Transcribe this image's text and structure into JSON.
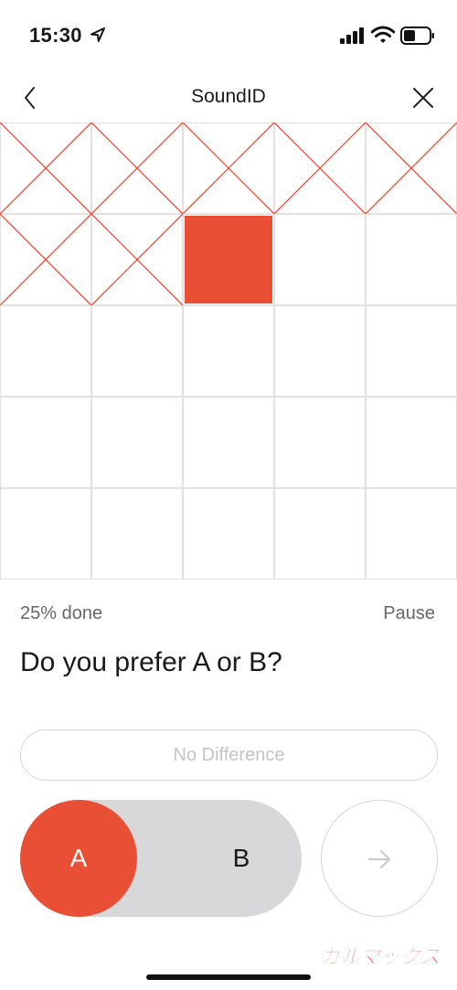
{
  "status_bar": {
    "time": "15:30",
    "icons": [
      "location-arrow-icon",
      "cellular-signal-icon",
      "wifi-icon",
      "battery-icon"
    ]
  },
  "nav": {
    "title": "SoundID",
    "back_icon": "chevron-left-icon",
    "close_icon": "close-icon"
  },
  "progress_grid": {
    "rows": 5,
    "columns": 5,
    "completed_cells": 7,
    "current_cell": 8,
    "total_cells": 25,
    "completed_marker": "cross",
    "accent_color": "#e94f35",
    "grid_line_color": "#e2e2e2"
  },
  "progress": {
    "done_text": "25% done",
    "pause_label": "Pause"
  },
  "question": "Do you prefer A or B?",
  "buttons": {
    "no_difference_label": "No Difference",
    "option_a_label": "A",
    "option_b_label": "B",
    "selected_option": "A",
    "next_icon": "arrow-right-icon"
  },
  "watermark": {
    "text": "ガルマックス",
    "color": "#e8202a"
  }
}
